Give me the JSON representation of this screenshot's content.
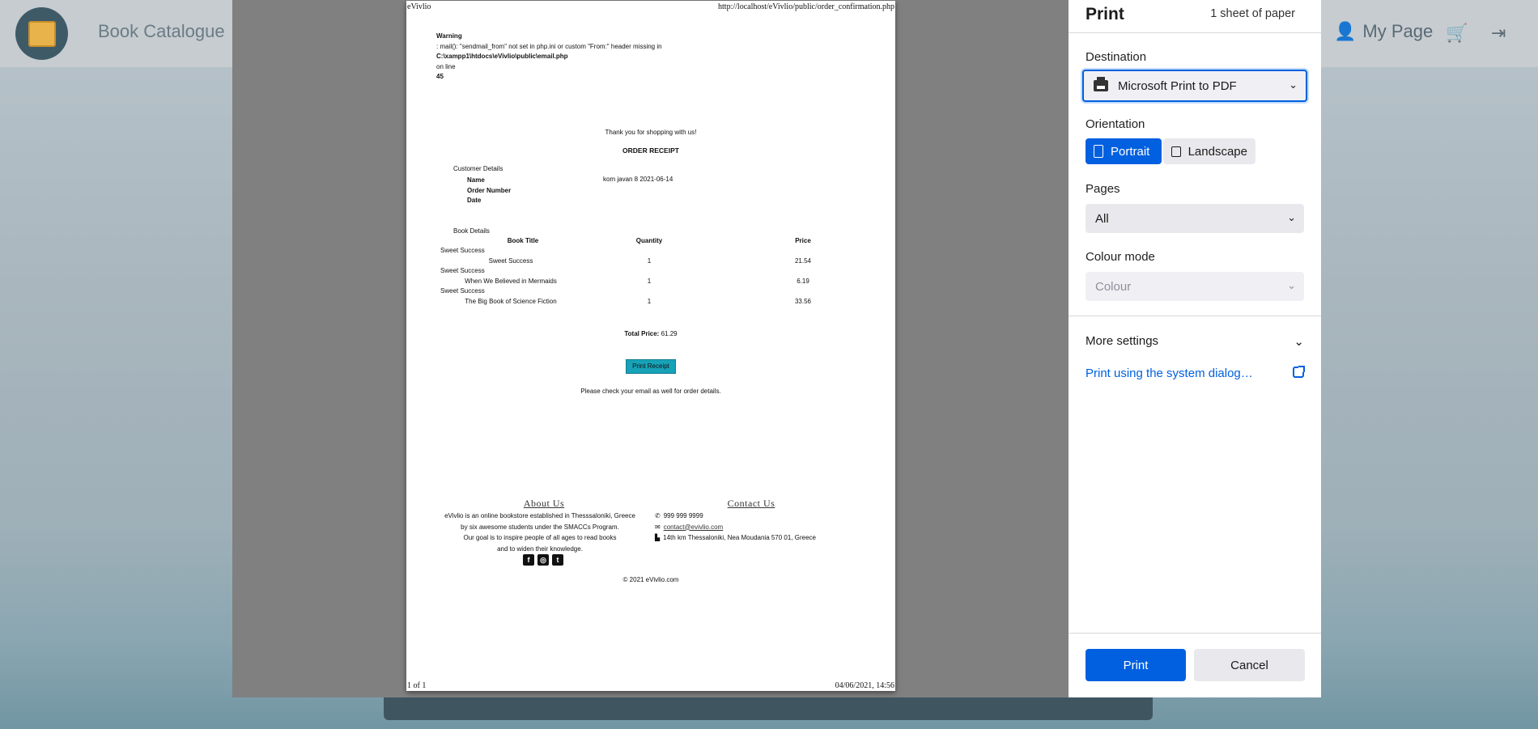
{
  "background": {
    "brand": "Book Catalogue",
    "my_page": "My Page"
  },
  "preview": {
    "header_left": "eVivlio",
    "header_right": "http://localhost/eVivlio/public/order_confirmation.php",
    "footer_left": "1 of 1",
    "footer_right": "04/06/2021, 14:56",
    "warning": {
      "title": "Warning",
      "line1": ": mail(): \"sendmail_from\" not set in php.ini or custom \"From:\" header missing in",
      "path": "C:\\xampp1\\htdocs\\eVivlio\\public\\email.php",
      "online": "on line",
      "line_no": "45"
    },
    "thanks": "Thank you for shopping with us!",
    "receipt_title": "ORDER RECEIPT",
    "customer_details_title": "Customer Details",
    "customer_labels": [
      "Name",
      "Order Number",
      "Date"
    ],
    "customer_value": "kom javan 8 2021-06-14",
    "book_details_title": "Book Details",
    "table_headers": [
      "Book Title",
      "Quantity",
      "Price"
    ],
    "rows": [
      {
        "category": "Sweet Success",
        "title": "Sweet Success",
        "qty": "1",
        "price": "21.54"
      },
      {
        "category": "Sweet Success",
        "title": "When We Believed in Mermaids",
        "qty": "1",
        "price": "6.19"
      },
      {
        "category": "Sweet Success",
        "title": "The Big Book of Science Fiction",
        "qty": "1",
        "price": "33.56"
      }
    ],
    "total_label": "Total Price:",
    "total_value": " 61.29",
    "print_receipt": "Print Receipt",
    "email_note": "Please check your email as well for order details.",
    "about_heading": "About Us",
    "about_lines": [
      "eVivlio is an online bookstore established in Thesssaloniki, Greece",
      "by six awesome students under the SMACCs Program.",
      "Our goal is to inspire people of all ages to read books",
      "and to widen their knowledge."
    ],
    "contact_heading": "Contact Us",
    "contact_phone": "999 999 9999",
    "contact_email": "contact@evivlio.com",
    "contact_address": "14th km Thessaloniki, Nea Moudania 570 01, Greece",
    "copyright": "© 2021 eVivlio.com"
  },
  "panel": {
    "title": "Print",
    "sheet_count": "1 sheet of paper",
    "destination_label": "Destination",
    "destination_value": "Microsoft Print to PDF",
    "orientation_label": "Orientation",
    "portrait": "Portrait",
    "landscape": "Landscape",
    "pages_label": "Pages",
    "pages_value": "All",
    "colour_label": "Colour mode",
    "colour_value": "Colour",
    "more_settings": "More settings",
    "system_dialog": "Print using the system dialog…",
    "print_button": "Print",
    "cancel_button": "Cancel"
  },
  "colors": {
    "accent": "#0060df",
    "receipt_button": "#17a2b8"
  }
}
